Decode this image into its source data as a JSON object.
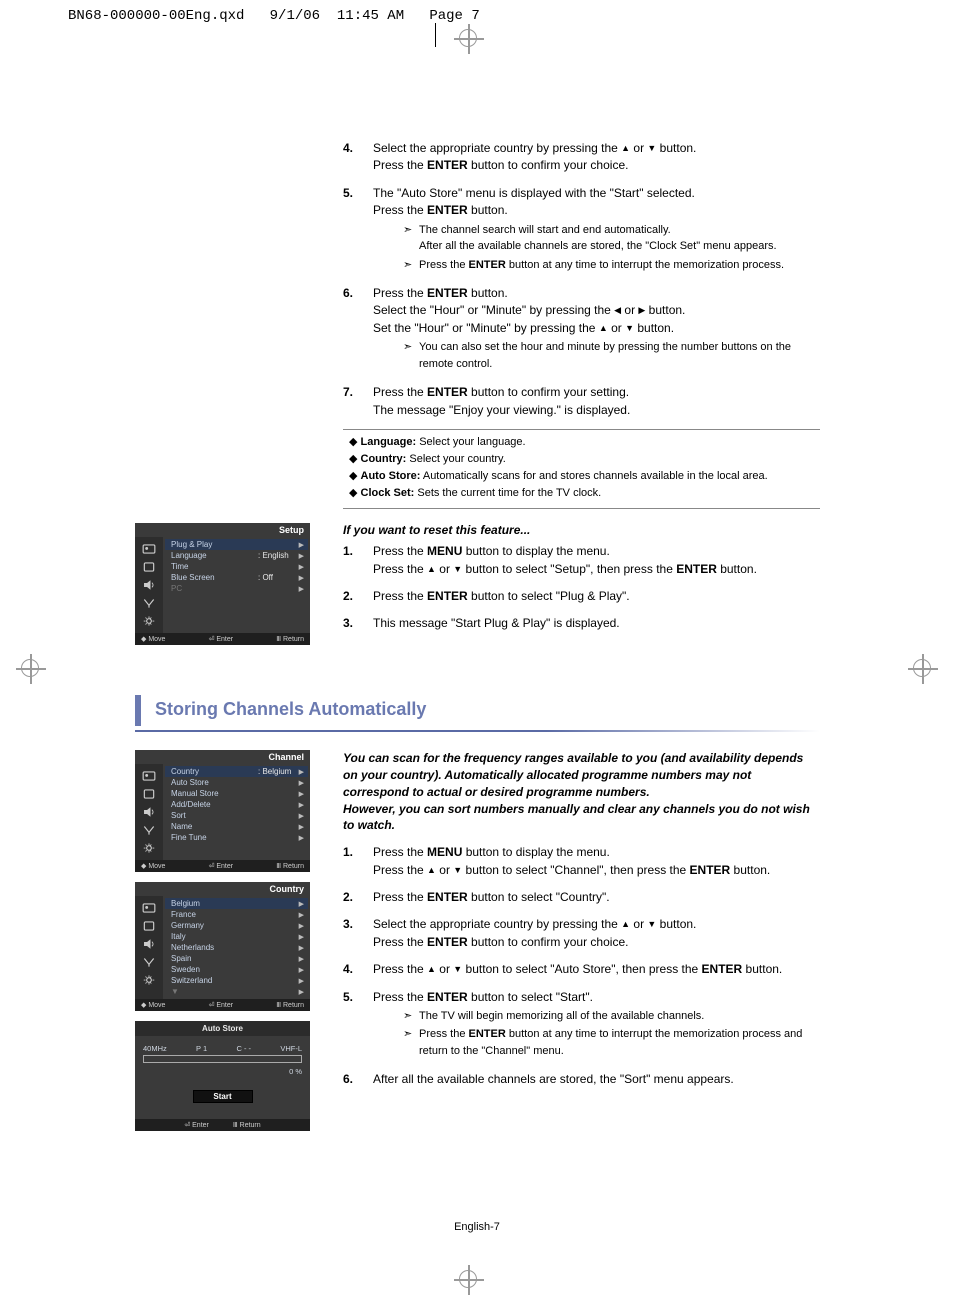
{
  "header": {
    "file": "BN68-000000-00Eng.qxd",
    "date": "9/1/06",
    "time": "11:45 AM",
    "pagePrefix": "Page",
    "pageNum": "7"
  },
  "footer": {
    "label": "English-7"
  },
  "block1": {
    "items": [
      {
        "num": "4.",
        "lines": [
          [
            "Select the appropriate country by pressing the  ",
            "▲",
            "  or  ",
            "▼",
            "  button."
          ],
          [
            "Press the ",
            "ENTER",
            " button to confirm your choice."
          ]
        ]
      },
      {
        "num": "5.",
        "lines": [
          [
            "The \"Auto Store\" menu is displayed with the \"Start\" selected."
          ],
          [
            "Press the ",
            "ENTER",
            " button."
          ]
        ],
        "subs": [
          [
            "The channel search will start and end automatically.",
            "After all the available channels are stored, the \"Clock Set\" menu appears."
          ],
          [
            "Press the ",
            "ENTER",
            " button at any time to interrupt the memorization process."
          ]
        ]
      },
      {
        "num": "6.",
        "lines": [
          [
            "Press the ",
            "ENTER",
            " button."
          ],
          [
            "Select the \"Hour\" or \"Minute\" by pressing the  ",
            "◀",
            " or ",
            "▶",
            "  button."
          ],
          [
            "Set the \"Hour\" or \"Minute\" by pressing the  ",
            "▲",
            " or ",
            "▼",
            "  button."
          ]
        ],
        "subs": [
          [
            "You can also set the hour and minute by pressing the number buttons on the remote control."
          ]
        ]
      },
      {
        "num": "7.",
        "lines": [
          [
            "Press the ",
            "ENTER",
            " button to confirm your setting."
          ],
          [
            "The message \"Enjoy your viewing.\" is displayed."
          ]
        ]
      }
    ],
    "bullets": [
      [
        "Language:",
        " Select your language."
      ],
      [
        "Country:",
        " Select your country."
      ],
      [
        "Auto Store:",
        " Automatically scans for and stores channels available in the local area."
      ],
      [
        "Clock Set:",
        " Sets the current time for the TV clock."
      ]
    ]
  },
  "reset": {
    "heading": "If you want to reset this feature...",
    "items": [
      {
        "num": "1.",
        "lines": [
          [
            "Press the ",
            "MENU",
            " button to display the menu."
          ],
          [
            "Press the  ",
            "▲",
            "  or  ",
            "▼",
            "  button to select \"Setup\", then press the ",
            "ENTER",
            " button."
          ]
        ]
      },
      {
        "num": "2.",
        "lines": [
          [
            "Press the ",
            "ENTER",
            " button to select \"Plug & Play\"."
          ]
        ]
      },
      {
        "num": "3.",
        "lines": [
          [
            "This message \"Start Plug & Play\" is displayed."
          ]
        ]
      }
    ],
    "osd": {
      "title": "Setup",
      "rows": [
        {
          "lbl": "Plug & Play",
          "val": "",
          "sel": true
        },
        {
          "lbl": "Language",
          "val": ": English"
        },
        {
          "lbl": "Time",
          "val": ""
        },
        {
          "lbl": "Blue Screen",
          "val": ": Off"
        },
        {
          "lbl": "PC",
          "val": "",
          "dim": true
        }
      ],
      "foot": {
        "move": "Move",
        "enter": "Enter",
        "ret": "Return"
      }
    }
  },
  "section2": {
    "heading": "Storing Channels Automatically",
    "intro": [
      "You can scan for the frequency ranges available to you (and availability depends on your country). Automatically allocated programme numbers may not correspond to actual or desired programme numbers.",
      "However, you can sort numbers manually and clear any channels you do not wish to watch."
    ],
    "items": [
      {
        "num": "1.",
        "lines": [
          [
            "Press the ",
            "MENU",
            " button to display the menu."
          ],
          [
            "Press the  ",
            "▲",
            "  or  ",
            "▼",
            "  button to select \"Channel\", then press the ",
            "ENTER",
            " button."
          ]
        ]
      },
      {
        "num": "2.",
        "lines": [
          [
            "Press the ",
            "ENTER",
            " button to select \"Country\"."
          ]
        ]
      },
      {
        "num": "3.",
        "lines": [
          [
            "Select the appropriate country by pressing the  ",
            "▲",
            "  or  ",
            "▼",
            "  button."
          ],
          [
            "Press the ",
            "ENTER",
            " button to confirm your choice."
          ]
        ]
      },
      {
        "num": "4.",
        "lines": [
          [
            "Press the  ",
            "▲",
            "  or  ",
            "▼",
            "  button to select \"Auto Store\", then press the ",
            "ENTER",
            " button."
          ]
        ]
      },
      {
        "num": "5.",
        "lines": [
          [
            "Press the ",
            "ENTER",
            " button to select \"Start\"."
          ]
        ],
        "subs": [
          [
            "The TV will begin memorizing all of the available channels."
          ],
          [
            "Press the ",
            "ENTER",
            " button at any time to interrupt the memorization process and return to the \"Channel\" menu."
          ]
        ]
      },
      {
        "num": "6.",
        "lines": [
          [
            "After all the available channels are stored, the \"Sort\" menu appears."
          ]
        ]
      }
    ],
    "osd1": {
      "title": "Channel",
      "rows": [
        {
          "lbl": "Country",
          "val": ": Belgium",
          "sel": true
        },
        {
          "lbl": "Auto Store",
          "val": ""
        },
        {
          "lbl": "Manual Store",
          "val": ""
        },
        {
          "lbl": "Add/Delete",
          "val": ""
        },
        {
          "lbl": "Sort",
          "val": ""
        },
        {
          "lbl": "Name",
          "val": ""
        },
        {
          "lbl": "Fine Tune",
          "val": ""
        }
      ],
      "foot": {
        "move": "Move",
        "enter": "Enter",
        "ret": "Return"
      }
    },
    "osd2": {
      "title": "Country",
      "rows": [
        {
          "lbl": "Belgium",
          "sel": true
        },
        {
          "lbl": "France"
        },
        {
          "lbl": "Germany"
        },
        {
          "lbl": "Italy"
        },
        {
          "lbl": "Netherlands"
        },
        {
          "lbl": "Spain"
        },
        {
          "lbl": "Sweden"
        },
        {
          "lbl": "Switzerland"
        },
        {
          "lbl": "▼",
          "dim": true
        }
      ],
      "foot": {
        "move": "Move",
        "enter": "Enter",
        "ret": "Return"
      }
    },
    "osd3": {
      "title": "Auto Store",
      "meta": {
        "freq": "40MHz",
        "prog": "P 1",
        "ch": "C - -",
        "band": "VHF-L"
      },
      "pct": "0 %",
      "start": "Start",
      "foot": {
        "enter": "Enter",
        "ret": "Return"
      }
    }
  }
}
